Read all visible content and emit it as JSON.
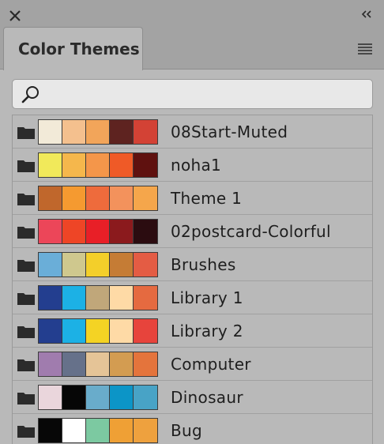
{
  "panel": {
    "tab_label": "Color Themes",
    "search_placeholder": ""
  },
  "icons": [
    "close-icon",
    "collapse-icon",
    "hamburger-menu-icon",
    "search-icon",
    "folder-icon"
  ],
  "themes": [
    {
      "name": "08Start-Muted",
      "colors": [
        "#f2ead8",
        "#f4c08e",
        "#f2a55a",
        "#5e2320",
        "#d34235"
      ]
    },
    {
      "name": "noha1",
      "colors": [
        "#f1e95a",
        "#f5b74c",
        "#f4964a",
        "#ef5a27",
        "#5f110f"
      ]
    },
    {
      "name": "Theme 1",
      "colors": [
        "#c0672c",
        "#f59a30",
        "#ee6b3c",
        "#f3925c",
        "#f5a64b"
      ]
    },
    {
      "name": "02postcard-Colorful",
      "colors": [
        "#ec4659",
        "#ee4526",
        "#e81f27",
        "#8b1a1d",
        "#2b0c10"
      ]
    },
    {
      "name": "Brushes",
      "colors": [
        "#6aaed8",
        "#cfc88e",
        "#f3cf2a",
        "#c57c35",
        "#e45c44"
      ]
    },
    {
      "name": "Library 1",
      "colors": [
        "#233e8f",
        "#1cb1e5",
        "#c0a77a",
        "#fedaa6",
        "#e56a40"
      ]
    },
    {
      "name": "Library 2",
      "colors": [
        "#233e8f",
        "#1cb1e5",
        "#f4d324",
        "#fedaa6",
        "#e7443c"
      ]
    },
    {
      "name": "Computer",
      "colors": [
        "#a07cae",
        "#66718a",
        "#e5c497",
        "#d39c51",
        "#e4743c"
      ]
    },
    {
      "name": "Dinosaur",
      "colors": [
        "#ead6dc",
        "#060606",
        "#69accb",
        "#0c95c7",
        "#48a3c6"
      ]
    },
    {
      "name": "Bug",
      "colors": [
        "#070707",
        "#ffffff",
        "#7cc9a1",
        "#efa035",
        "#eea13e"
      ]
    }
  ]
}
